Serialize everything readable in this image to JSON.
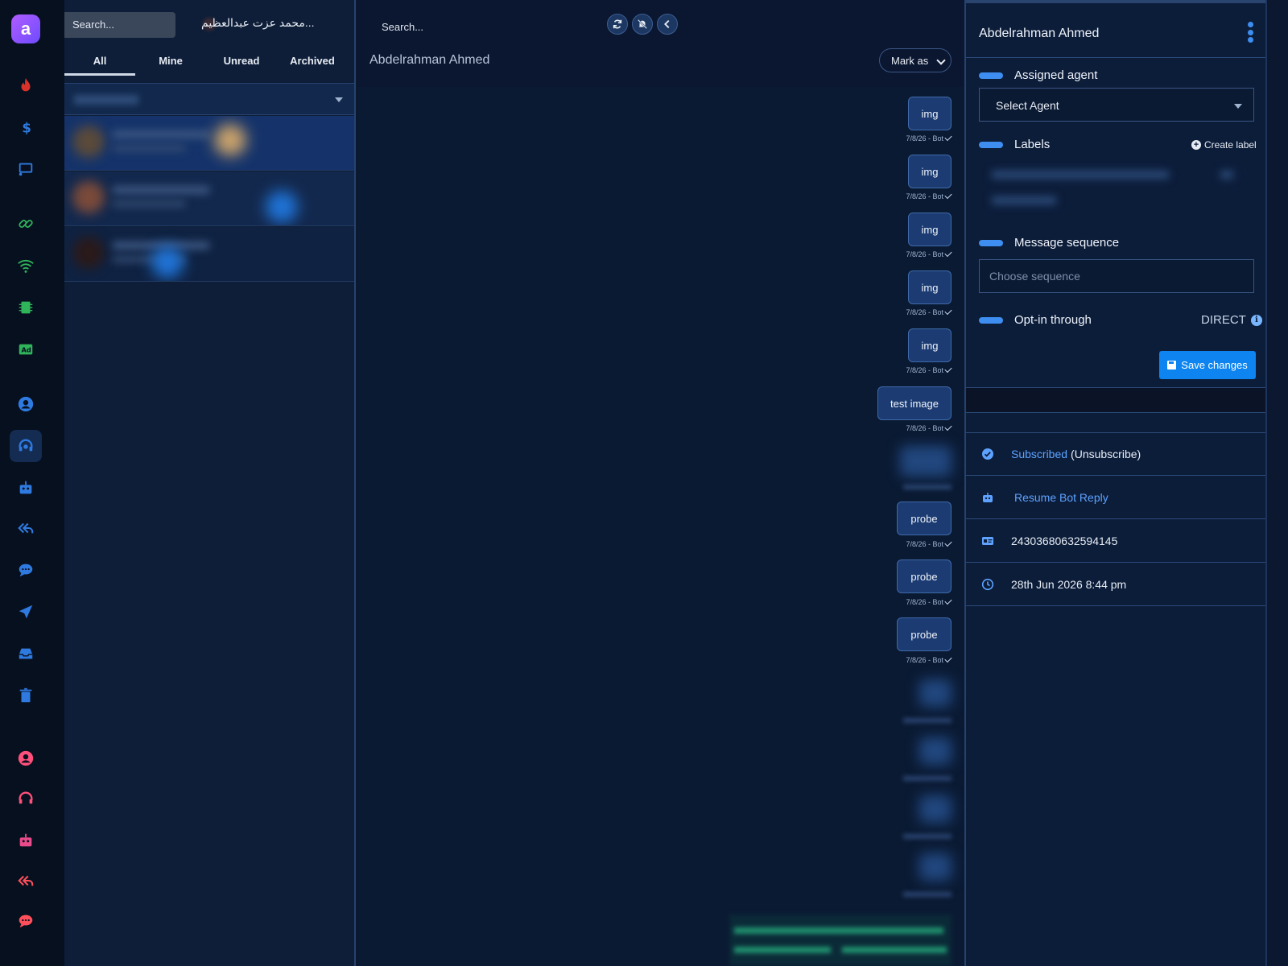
{
  "app": {
    "logo_letter": "a"
  },
  "list": {
    "search_placeholder": "Search...",
    "header_name": "...محمد عزت عبدالعظيم",
    "tabs": [
      "All",
      "Mine",
      "Unread",
      "Archived"
    ],
    "active_tab": "All"
  },
  "chat": {
    "search_placeholder": "Search...",
    "title": "Abdelrahman Ahmed",
    "mark_as_label": "Mark as",
    "messages": [
      {
        "text": "img",
        "meta": "7/8/26 - Bot"
      },
      {
        "text": "img",
        "meta": "7/8/26 - Bot"
      },
      {
        "text": "img",
        "meta": "7/8/26 - Bot"
      },
      {
        "text": "img",
        "meta": "7/8/26 - Bot"
      },
      {
        "text": "img",
        "meta": "7/8/26 - Bot"
      },
      {
        "text": "test image",
        "meta": "7/8/26 - Bot"
      },
      {
        "text": "probe",
        "meta": "7/8/26 - Bot"
      },
      {
        "text": "probe",
        "meta": "7/8/26 - Bot"
      },
      {
        "text": "probe",
        "meta": "7/8/26 - Bot"
      }
    ]
  },
  "details": {
    "name": "Abdelrahman Ahmed",
    "assigned_agent_label": "Assigned agent",
    "select_agent": "Select Agent",
    "labels_label": "Labels",
    "create_label": "Create label",
    "sequence_label": "Message sequence",
    "sequence_placeholder": "Choose sequence",
    "optin_label": "Opt-in through",
    "optin_value": "DIRECT",
    "save_label": "Save changes",
    "subscribed": "Subscribed",
    "unsubscribe": "(Unsubscribe)",
    "resume_bot": "Resume Bot Reply",
    "user_id": "24303680632594145",
    "date": "28th Jun 2026 8:44 pm"
  },
  "colors": {
    "accent": "#3d8ef0",
    "save_button": "#0d84f0",
    "link": "#5ea2ff"
  }
}
